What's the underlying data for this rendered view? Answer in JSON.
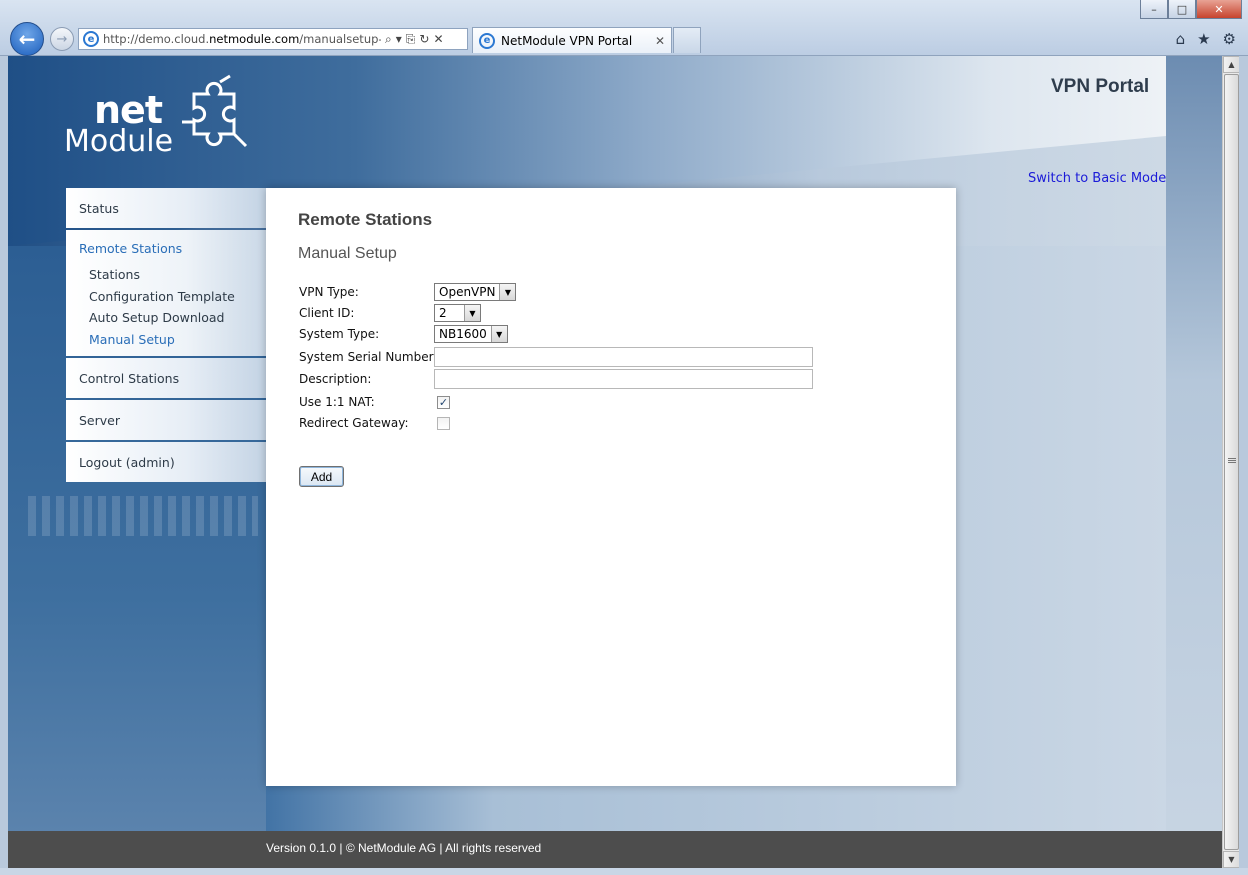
{
  "browser": {
    "url_prefix": "http://demo.cloud.",
    "url_domain": "netmodule.com",
    "url_suffix": "/manualsetup-joi",
    "tab_title": "NetModule VPN Portal",
    "window_buttons": [
      "–",
      "□",
      "✕"
    ]
  },
  "header": {
    "logo_top": "net",
    "logo_bottom": "Module",
    "portal_title": "VPN Portal",
    "switch_mode_link": "Switch to Basic Mode"
  },
  "nav": {
    "status": "Status",
    "remote_stations": {
      "label": "Remote Stations",
      "items": [
        "Stations",
        "Configuration Template",
        "Auto Setup Download",
        "Manual Setup"
      ]
    },
    "control_stations": "Control Stations",
    "server": "Server",
    "logout": "Logout (admin)"
  },
  "content": {
    "title": "Remote Stations",
    "subtitle": "Manual Setup",
    "vpn_type": {
      "label": "VPN Type:",
      "value": "OpenVPN"
    },
    "client_id": {
      "label": "Client ID:",
      "value": "2"
    },
    "system_type": {
      "label": "System Type:",
      "value": "NB1600"
    },
    "serial_number": {
      "label": "System Serial Number:",
      "value": ""
    },
    "description": {
      "label": "Description:",
      "value": ""
    },
    "nat": {
      "label": "Use 1:1 NAT:",
      "checked": true
    },
    "redirect_gateway": {
      "label": "Redirect Gateway:",
      "checked": false
    },
    "add_button": "Add"
  },
  "footer": {
    "text": "Version 0.1.0 | © NetModule AG | All rights reserved"
  },
  "colors": {
    "link": "#1b1bd8",
    "nav_active": "#2a6eb8",
    "footer_bg": "#4d4d4d"
  }
}
